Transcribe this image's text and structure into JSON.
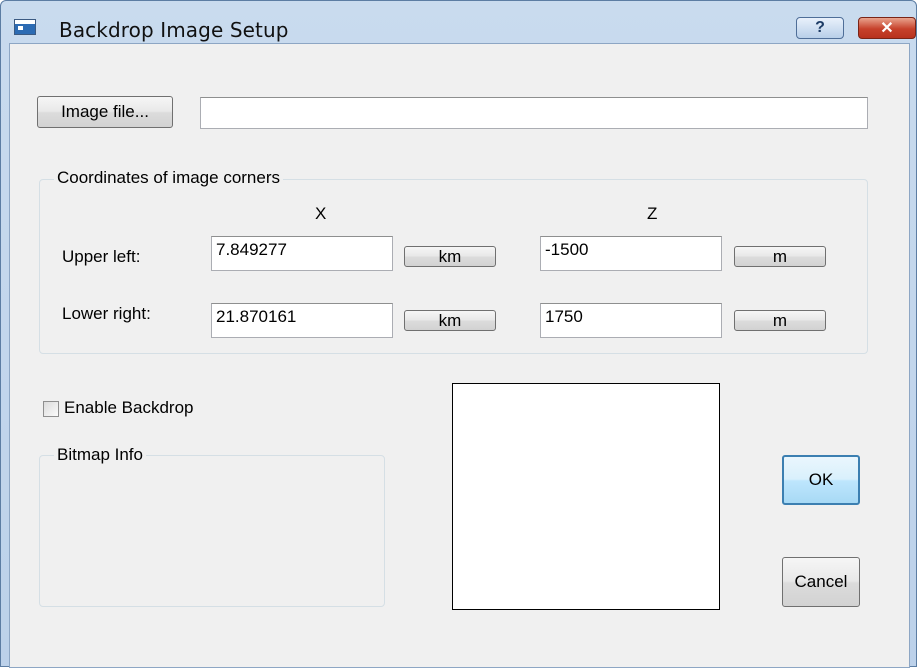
{
  "window": {
    "title": "Backdrop Image Setup",
    "help_glyph": "?",
    "close_glyph": "✕"
  },
  "image_file": {
    "button_label": "Image file...",
    "path_value": ""
  },
  "coordinates": {
    "group_label": "Coordinates of image corners",
    "x_header": "X",
    "z_header": "Z",
    "upper_left": {
      "label": "Upper left:",
      "x_value": "7.849277",
      "x_unit": "km",
      "z_value": "-1500",
      "z_unit": "m"
    },
    "lower_right": {
      "label": "Lower right:",
      "x_value": "21.870161",
      "x_unit": "km",
      "z_value": "1750",
      "z_unit": "m"
    }
  },
  "enable_backdrop": {
    "label": "Enable Backdrop",
    "checked": false
  },
  "bitmap_info": {
    "group_label": "Bitmap Info"
  },
  "buttons": {
    "ok": "OK",
    "cancel": "Cancel"
  },
  "colors": {
    "title_bar": "#bcd1ea",
    "dialog_bg": "#f0f0f0",
    "close_button": "#c6412b",
    "ok_border": "#3c7fb1"
  }
}
